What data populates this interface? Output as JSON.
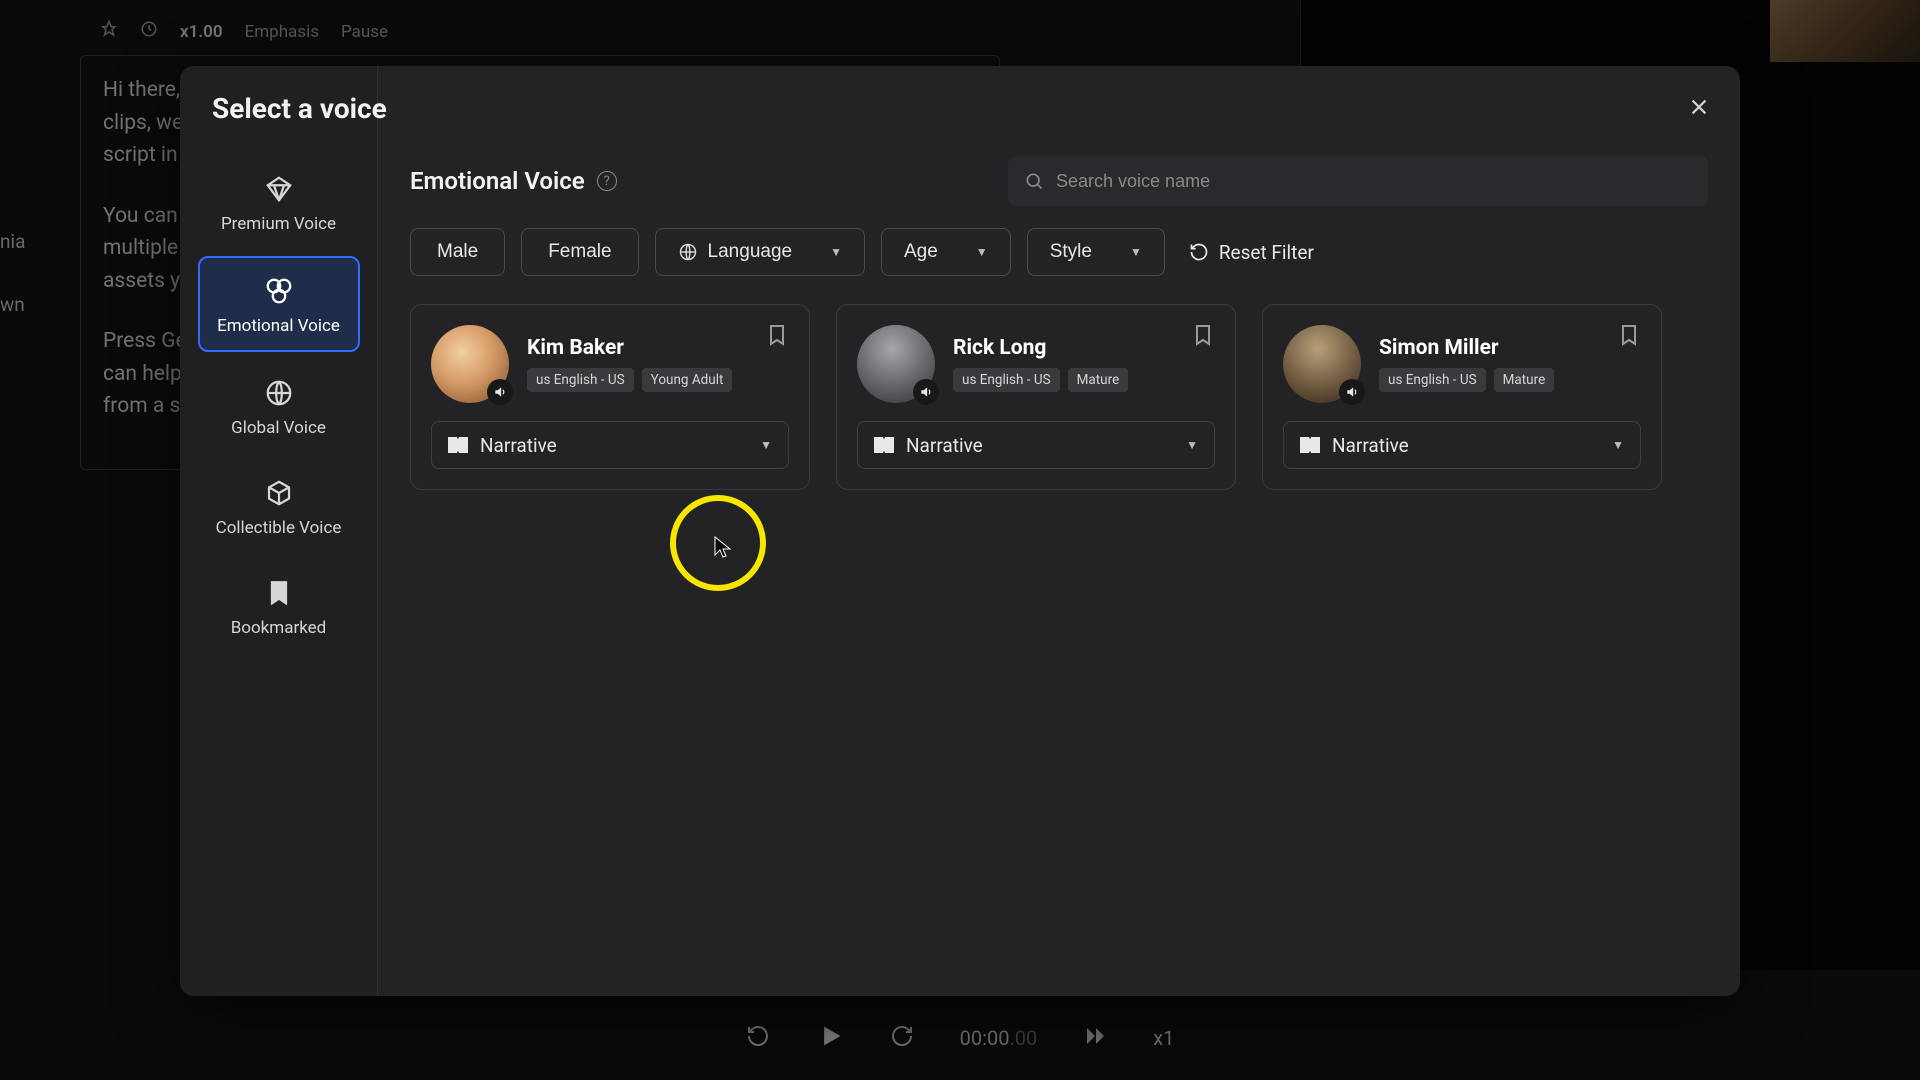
{
  "backdrop": {
    "toolbar": {
      "speed": "x1.00",
      "emphasis": "Emphasis",
      "pause": "Pause"
    },
    "script": {
      "p1": "Hi there, welcome to DeepAI Video. From engaging product demos to dynamic social media clips, we empower you to create videos that leave a lasting impression. Simply type your script in this document.",
      "p2": "You can switch between talking photo and avatars by just one click. Your avatar can speak in multiple AI voices in 10+ languages. You have access to commercially licensed creative assets you can use to create videos that stand out.",
      "p3": "Press Generate to transcribe your script into a video. If you don't have a script, Deepbrain AI can help you autogenerate one in the current section or even create an entirely new video from a simple topic. Happy creating!"
    },
    "left_labels": {
      "a": "nia",
      "b": "wn"
    },
    "playbar": {
      "time": "00:00",
      "time_frac": ".00",
      "rate": "x1"
    }
  },
  "modal": {
    "title": "Select a voice",
    "section_title": "Emotional Voice",
    "search_placeholder": "Search voice name",
    "sidebar": [
      {
        "id": "premium",
        "label": "Premium Voice"
      },
      {
        "id": "emotional",
        "label": "Emotional Voice"
      },
      {
        "id": "global",
        "label": "Global Voice"
      },
      {
        "id": "collectible",
        "label": "Collectible Voice"
      },
      {
        "id": "bookmarked",
        "label": "Bookmarked"
      }
    ],
    "filters": {
      "male": "Male",
      "female": "Female",
      "language": "Language",
      "age": "Age",
      "style": "Style",
      "reset": "Reset Filter"
    },
    "voices": [
      {
        "name": "Kim Baker",
        "lang": "us English - US",
        "age": "Young Adult",
        "style": "Narrative"
      },
      {
        "name": "Rick Long",
        "lang": "us English - US",
        "age": "Mature",
        "style": "Narrative"
      },
      {
        "name": "Simon Miller",
        "lang": "us English - US",
        "age": "Mature",
        "style": "Narrative"
      }
    ]
  }
}
